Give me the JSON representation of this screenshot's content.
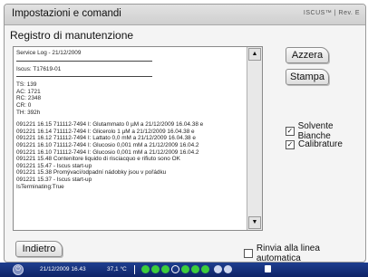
{
  "window": {
    "title": "Impostazioni e comandi",
    "brand": "ISCUS™ | Rev. E"
  },
  "subtitle": "Registro di manutenzione",
  "log": {
    "lines": [
      {
        "text": "Service Log - 21/12/2009"
      },
      {
        "kind": "sep"
      },
      {
        "text": "Iscus: T17619-01"
      },
      {
        "kind": "sep"
      },
      {
        "text": "TS: 139"
      },
      {
        "text": "AC: 1721"
      },
      {
        "text": "RC: 2348"
      },
      {
        "text": "CR: 0"
      },
      {
        "text": "TH: 392h"
      },
      {
        "kind": "gap"
      },
      {
        "text": "091221 16.15 711112-7494 I: Glutammato 0 µM a 21/12/2009 16.04.38 e"
      },
      {
        "text": "091221 16.14 711112-7494 I: Glicerolo 1 µM a 21/12/2009 16.04.38 e"
      },
      {
        "text": "091221 16.12 711112-7494 I: Lattato 0,0 mM a 21/12/2009 16.04.38 e"
      },
      {
        "text": "091221 16.10 711112-7494 I: Glucosio 0,001 mM a 21/12/2009 16.04.2"
      },
      {
        "text": "091221 16.10 711112-7494 I: Glucosio 0,001 mM a 21/12/2009 16.04.2"
      },
      {
        "text": "091221 15.48 Contenitore liquido di risciacquo e rifiuto sono OK"
      },
      {
        "text": "091221 15.47 - Iscus start-up"
      },
      {
        "text": "091221 15.38 Promývací/odpadní nádobky jsou v pořádku"
      },
      {
        "text": "091221 15.37 - Iscus start-up"
      },
      {
        "text": "IsTerminating:True"
      }
    ]
  },
  "buttons": {
    "reset": "Azzera",
    "print": "Stampa",
    "back": "Indietro"
  },
  "checkboxes": {
    "solvent": {
      "label": "Solvente Bianche",
      "checked": true
    },
    "calibration": {
      "label": "Calibrature",
      "checked": true
    },
    "autowrap": {
      "label": "Rinvia alla linea automatica",
      "checked": false
    }
  },
  "status": {
    "datetime": "21/12/2009 16.43",
    "temperature": "37,1 °C"
  },
  "colors": {
    "status_bg": "#1a3580",
    "status_green": "#3ccd3c"
  }
}
